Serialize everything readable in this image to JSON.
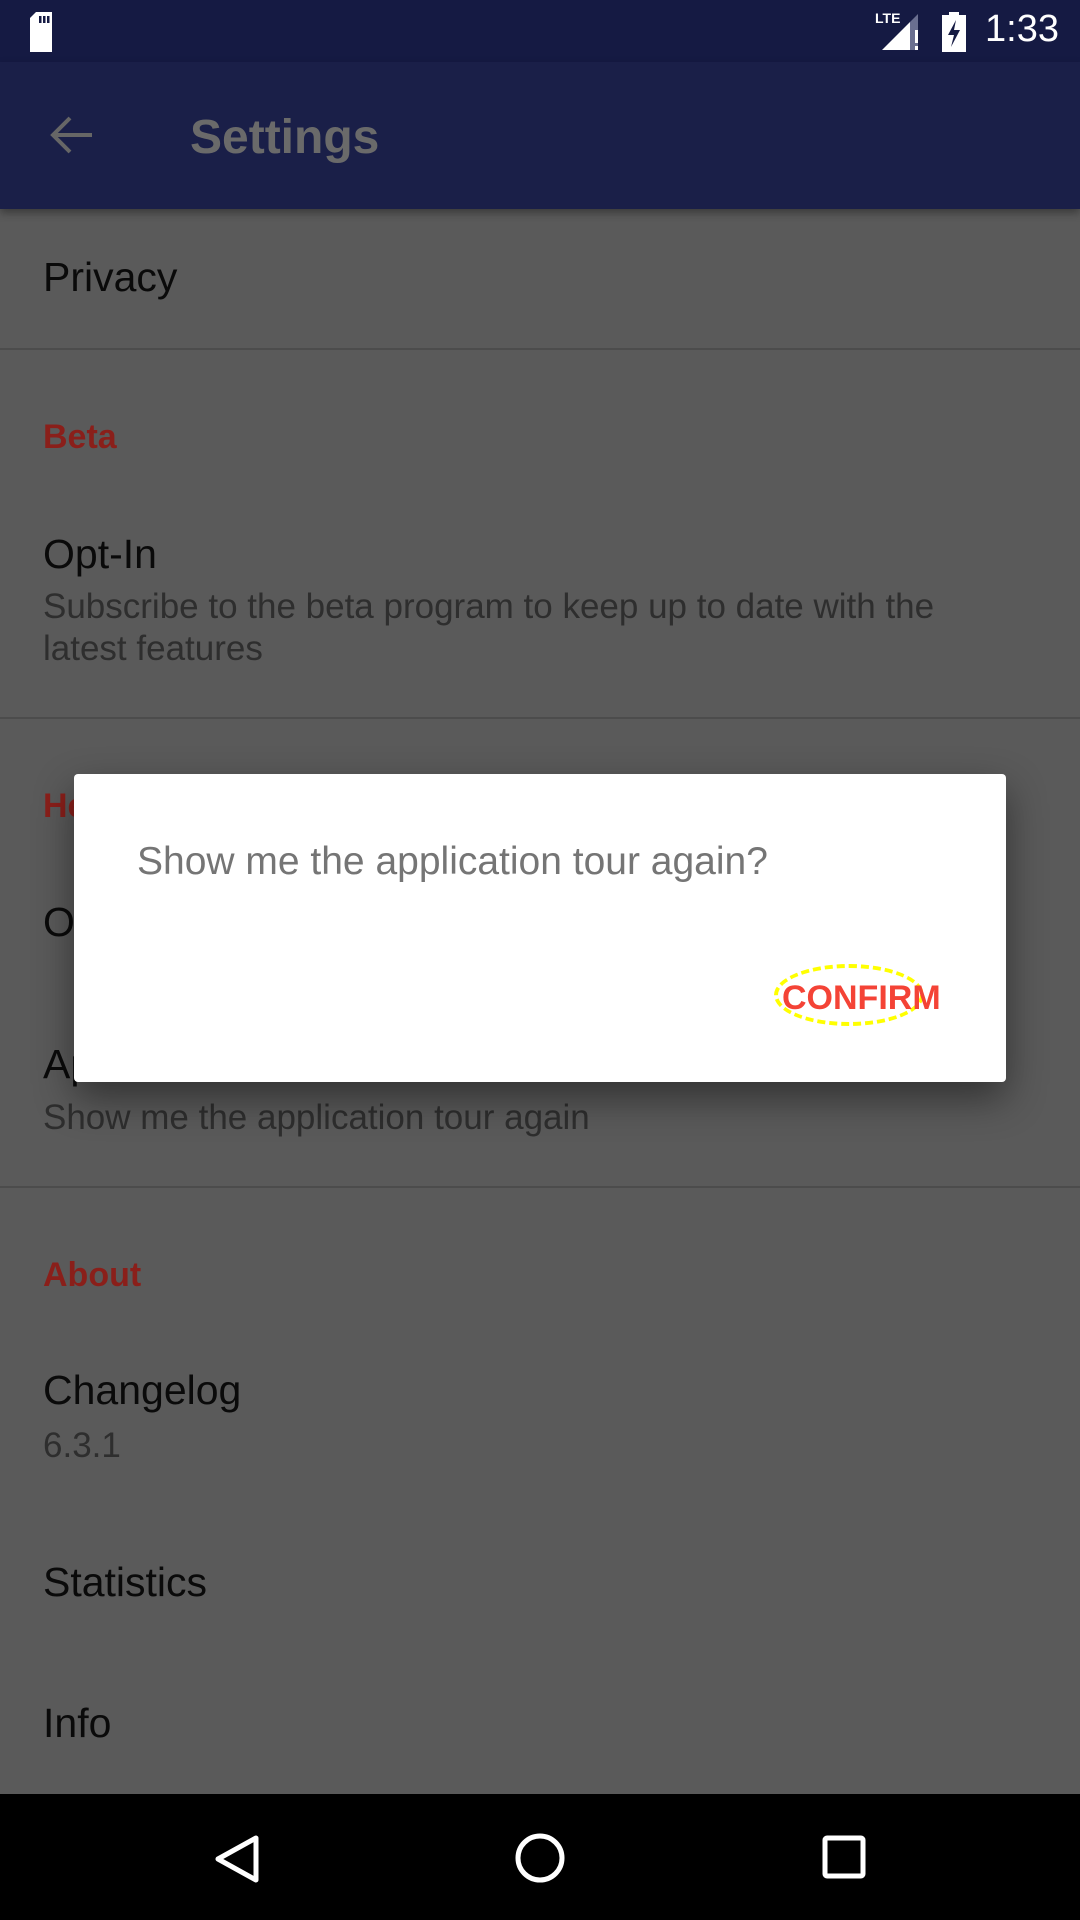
{
  "status_bar": {
    "time": "1:33",
    "network": "LTE"
  },
  "toolbar": {
    "title": "Settings"
  },
  "list": {
    "privacy": "Privacy",
    "beta_header": "Beta",
    "optin_title": "Opt-In",
    "optin_summary": "Subscribe to the beta program to keep up to date with the latest features",
    "help_header_partial": "He",
    "item_o_partial": "O",
    "apptour_partial": "Ap",
    "apptour_summary": "Show me the application tour again",
    "about_header": "About",
    "changelog_title": "Changelog",
    "changelog_version": "6.3.1",
    "statistics": "Statistics",
    "info": "Info"
  },
  "dialog": {
    "message": "Show me the application tour again?",
    "confirm": "CONFIRM"
  },
  "colors": {
    "accent": "#f44336",
    "primary_dark": "#151a43",
    "highlight": "#ffff00"
  }
}
